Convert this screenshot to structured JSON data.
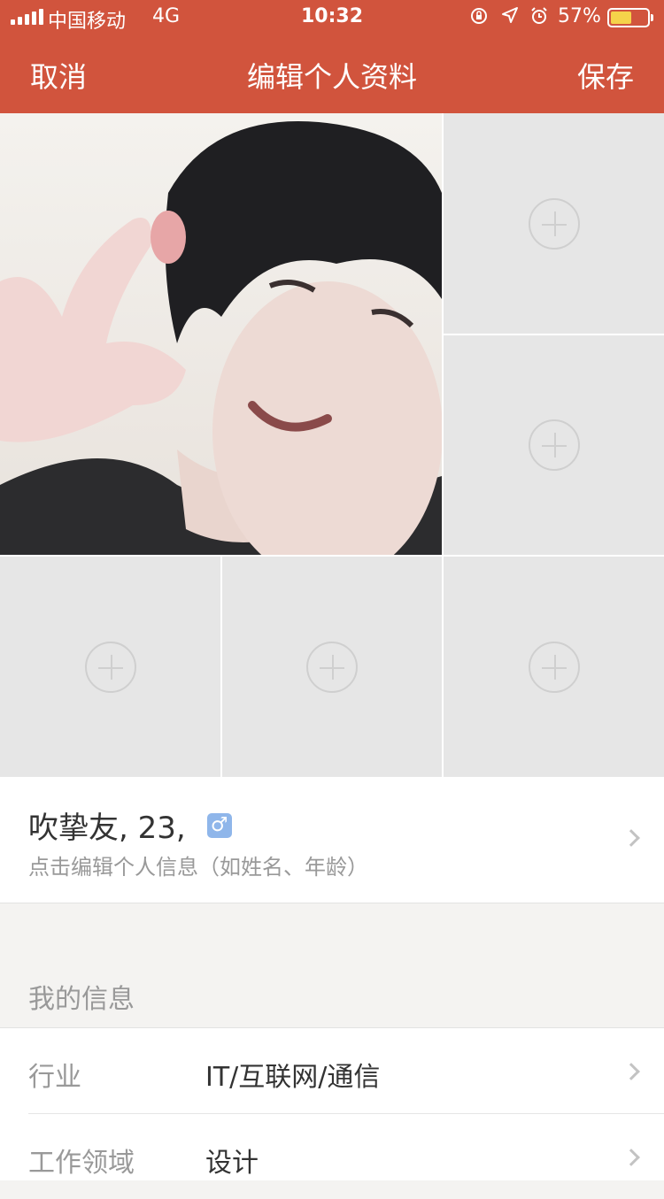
{
  "status_bar": {
    "carrier": "中国移动",
    "network": "4G",
    "time": "10:32",
    "battery_percent": "57%",
    "battery_level": 0.57,
    "icons": [
      "signal-icon",
      "rotation-lock-icon",
      "location-icon",
      "alarm-icon",
      "battery-icon"
    ]
  },
  "nav": {
    "cancel": "取消",
    "title": "编辑个人资料",
    "save": "保存"
  },
  "colors": {
    "header": "#d1543d",
    "gender_badge": "#8fb6ea",
    "battery_fill": "#f5d34a"
  },
  "photos": {
    "main_photo": "user-selfie-photo",
    "empty_slot_icon": "plus-circle-icon",
    "empty_slots": 5
  },
  "profile": {
    "name_age": "吹挚友, 23,",
    "gender_symbol": "♂",
    "hint": "点击编辑个人信息（如姓名、年龄）"
  },
  "my_info": {
    "section_title": "我的信息",
    "rows": [
      {
        "label": "行业",
        "value": "IT/互联网/通信"
      },
      {
        "label": "工作领域",
        "value": "设计"
      }
    ]
  }
}
